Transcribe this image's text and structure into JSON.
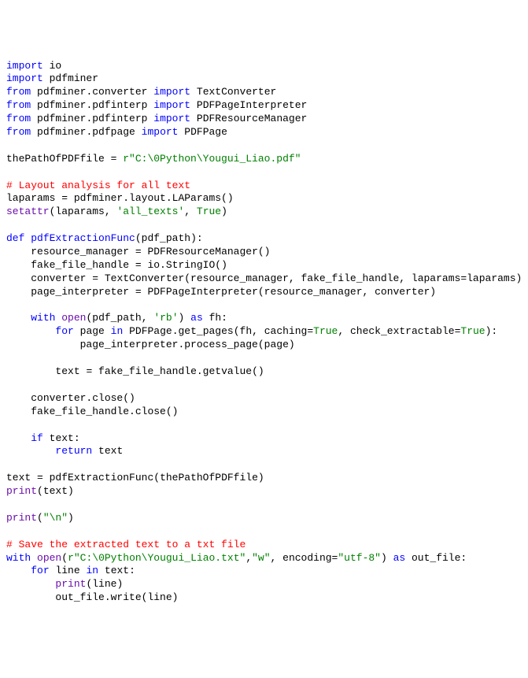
{
  "tokens": {
    "import": "import",
    "from": "from",
    "def": "def",
    "with": "with",
    "as": "as",
    "for": "for",
    "in": "in",
    "if": "if",
    "return": "return",
    "True": "True"
  },
  "modules": {
    "io": "io",
    "pdfminer": "pdfminer",
    "pdfminer_converter": "pdfminer.converter",
    "pdfminer_pdfinterp": "pdfminer.pdfinterp",
    "pdfminer_pdfpage": "pdfminer.pdfpage",
    "TextConverter": "TextConverter",
    "PDFPageInterpreter": "PDFPageInterpreter",
    "PDFResourceManager": "PDFResourceManager",
    "PDFPage": "PDFPage"
  },
  "vars": {
    "thePathOfPDFfile": "thePathOfPDFfile",
    "laparams": "laparams",
    "resource_manager": "resource_manager",
    "fake_file_handle": "fake_file_handle",
    "converter": "converter",
    "page_interpreter": "page_interpreter",
    "pdf_path": "pdf_path",
    "fh": "fh",
    "page": "page",
    "text": "text",
    "out_file": "out_file",
    "line": "line"
  },
  "strings": {
    "pdf_path_str": "r\"C:\\0Python\\Yougui_Liao.pdf\"",
    "all_texts": "'all_texts'",
    "rb": "'rb'",
    "newline": "\"\\n\"",
    "txt_path": "r\"C:\\0Python\\Yougui_Liao.txt\"",
    "w": "\"w\"",
    "utf8": "\"utf-8\""
  },
  "comments": {
    "layout": "# Layout analysis for all text",
    "save": "# Save the extracted text to a txt file"
  },
  "funcs": {
    "setattr": "setattr",
    "pdfExtractionFunc": "pdfExtractionFunc",
    "PDFResourceManager_call": "PDFResourceManager()",
    "StringIO": "io.StringIO()",
    "LAParams": "pdfminer.layout.LAParams()",
    "open": "open",
    "print": "print",
    "TextConverter_call": "TextConverter(resource_manager, fake_file_handle, laparams=laparams)",
    "PDFPageInterpreter_call": "PDFPageInterpreter(resource_manager, converter)",
    "get_pages": "PDFPage.get_pages(fh, caching=",
    "get_pages_end": ", check_extractable=",
    "process_page": "page_interpreter.process_page(page)",
    "getvalue": "fake_file_handle.getvalue()",
    "conv_close": "converter.close()",
    "ffh_close": "fake_file_handle.close()",
    "write": "out_file.write(line)"
  },
  "misc": {
    "eq": " = ",
    "encoding_kw": "encoding="
  }
}
